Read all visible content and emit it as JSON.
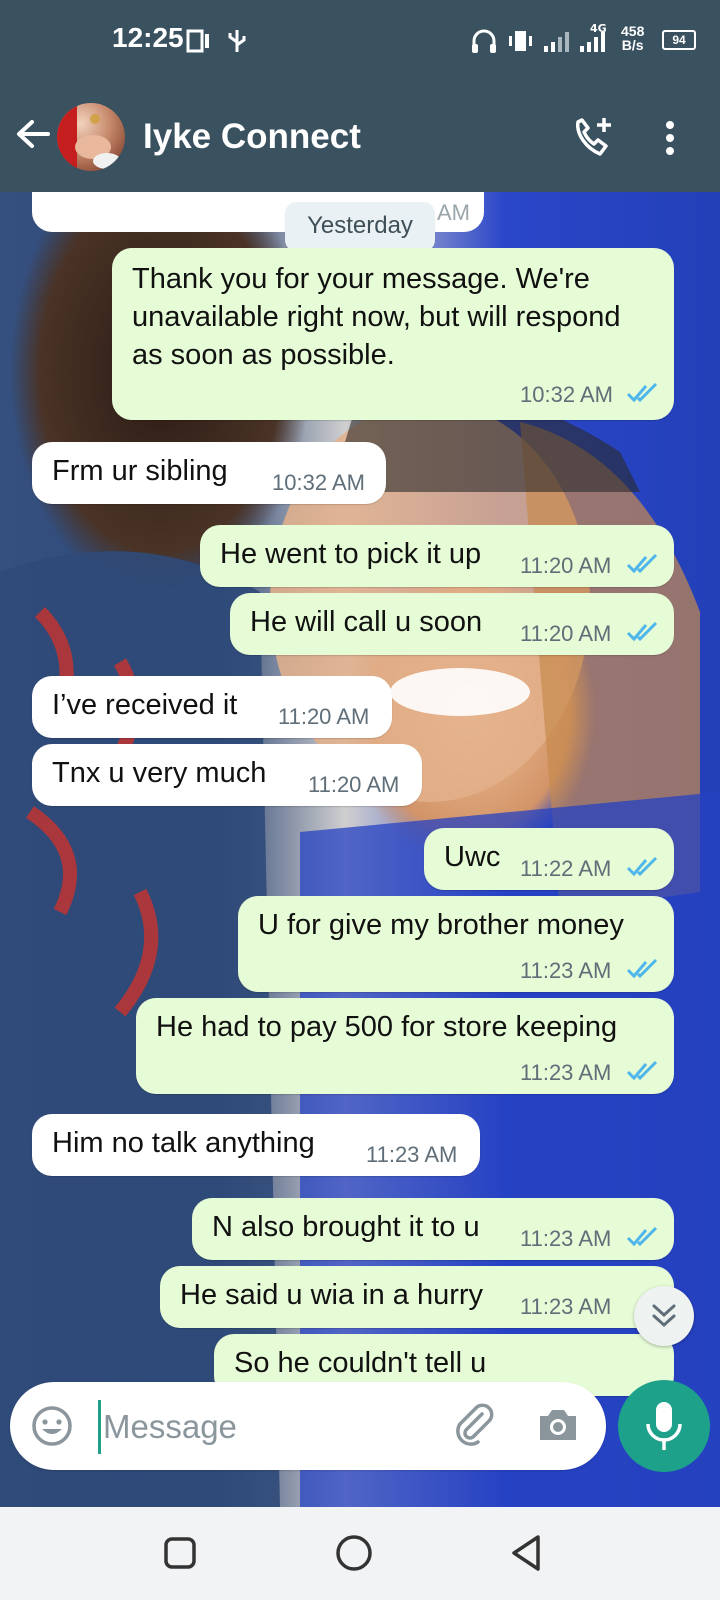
{
  "status_bar": {
    "time": "12:25",
    "network": "4G",
    "speed_value": "458",
    "speed_unit": "B/s",
    "battery": "94"
  },
  "header": {
    "contact_name": "Iyke Connect"
  },
  "chat": {
    "partial_top_time": "10:32 AM",
    "date_divider": "Yesterday",
    "messages": [
      {
        "dir": "out",
        "text": "Thank you for your message. We're unavailable right now, but will respond as soon as possible.",
        "time": "10:32 AM",
        "read": true
      },
      {
        "dir": "in",
        "text": "Frm ur sibling",
        "time": "10:32 AM"
      },
      {
        "dir": "out",
        "text": "He went to pick it up",
        "time": "11:20 AM",
        "read": true
      },
      {
        "dir": "out",
        "text": "He will call u soon",
        "time": "11:20 AM",
        "read": true
      },
      {
        "dir": "in",
        "text": "I’ve received it",
        "time": "11:20 AM"
      },
      {
        "dir": "in",
        "text": "Tnx u very much",
        "time": "11:20 AM"
      },
      {
        "dir": "out",
        "text": "Uwc",
        "time": "11:22 AM",
        "read": true
      },
      {
        "dir": "out",
        "text": "U for give my brother money",
        "time": "11:23 AM",
        "read": true
      },
      {
        "dir": "out",
        "text": "He had to pay 500 for store keeping",
        "time": "11:23 AM",
        "read": true
      },
      {
        "dir": "in",
        "text": "Him no talk anything",
        "time": "11:23 AM"
      },
      {
        "dir": "out",
        "text": "N also brought it to u",
        "time": "11:23 AM",
        "read": true
      },
      {
        "dir": "out",
        "text": "He said u wia in a hurry",
        "time": "11:23 AM",
        "read": true
      },
      {
        "dir": "out",
        "text": "So he couldn't tell u",
        "time": "",
        "read": true
      }
    ]
  },
  "input": {
    "placeholder": "Message"
  },
  "colors": {
    "header_bg": "#3a5260",
    "outgoing_bubble": "#e6fcd6",
    "incoming_bubble": "#ffffff",
    "accent": "#1ea18a",
    "read_ticks": "#4fb6ec"
  },
  "icons": [
    "back-arrow-icon",
    "add-call-icon",
    "more-vert-icon",
    "emoji-icon",
    "attach-icon",
    "camera-icon",
    "mic-icon",
    "scroll-down-icon",
    "nav-recents-icon",
    "nav-home-icon",
    "nav-back-icon"
  ]
}
